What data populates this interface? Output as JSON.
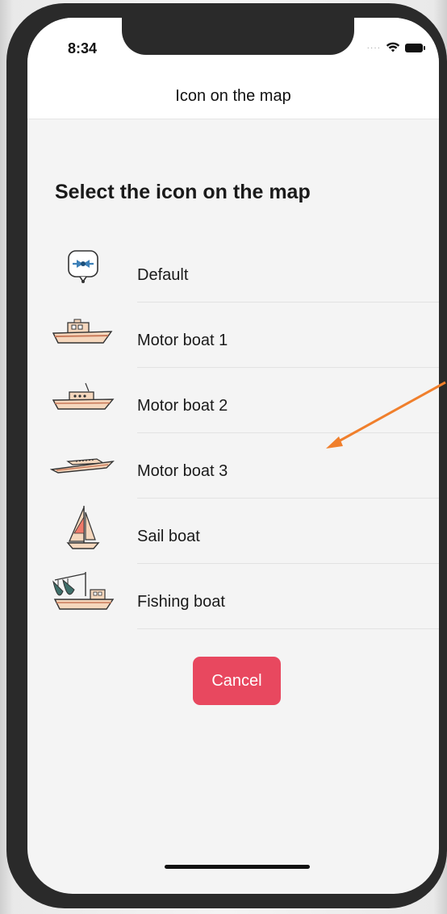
{
  "status_bar": {
    "time": "8:34",
    "signal": "····"
  },
  "nav": {
    "title": "Icon on the map"
  },
  "heading": "Select the icon on the map",
  "items": [
    {
      "label": "Default",
      "icon": "default-marker-icon"
    },
    {
      "label": "Motor boat 1",
      "icon": "motor-boat-1-icon"
    },
    {
      "label": "Motor boat 2",
      "icon": "motor-boat-2-icon"
    },
    {
      "label": "Motor boat 3",
      "icon": "motor-boat-3-icon"
    },
    {
      "label": "Sail boat",
      "icon": "sail-boat-icon"
    },
    {
      "label": "Fishing boat",
      "icon": "fishing-boat-icon"
    }
  ],
  "cancel_label": "Cancel",
  "colors": {
    "accent": "#e8485f",
    "annotation_arrow": "#f07f2c",
    "hull": "#f5d7bd",
    "background": "#f4f4f4"
  }
}
